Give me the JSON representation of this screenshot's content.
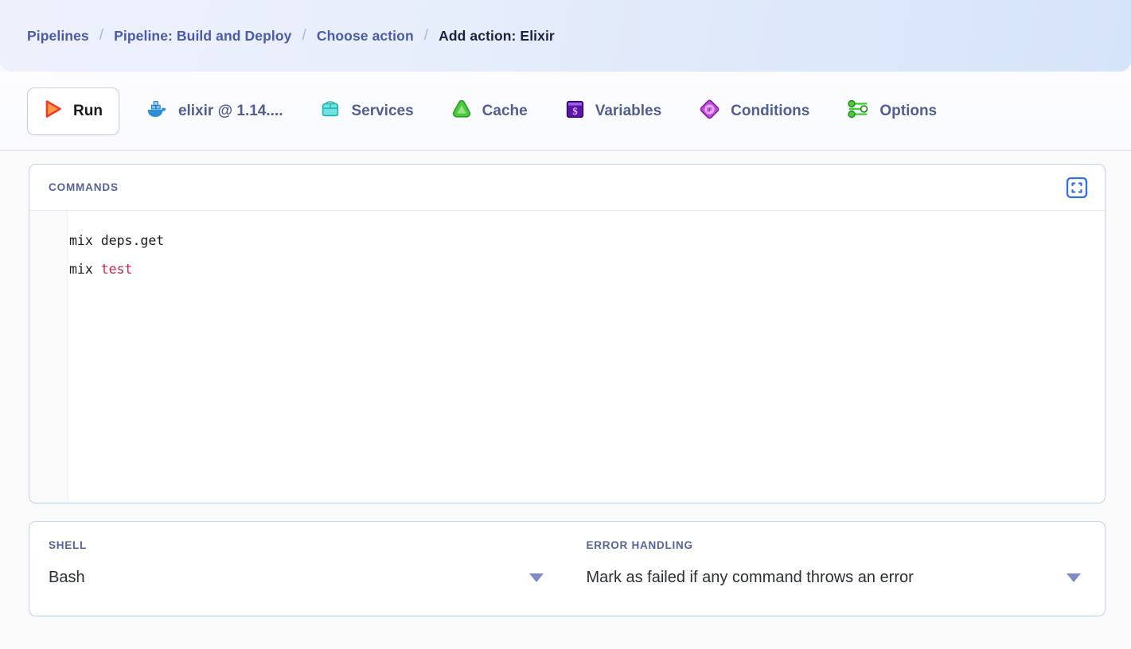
{
  "header": {
    "breadcrumb": [
      {
        "label": "Pipelines",
        "active": false
      },
      {
        "label": "Pipeline: Build and Deploy",
        "active": false
      },
      {
        "label": "Choose action",
        "active": false
      },
      {
        "label": "Add action: Elixir",
        "active": true
      }
    ],
    "separator": "/"
  },
  "tabs": {
    "run": {
      "label": "Run",
      "icon": "play-icon",
      "selected": true
    },
    "items": [
      {
        "label": "elixir @ 1.14....",
        "icon": "docker-whale-icon"
      },
      {
        "label": "Services",
        "icon": "services-crate-icon"
      },
      {
        "label": "Cache",
        "icon": "cache-triangle-icon"
      },
      {
        "label": "Variables",
        "icon": "variables-dollar-icon"
      },
      {
        "label": "Conditions",
        "icon": "conditions-if-diamond-icon"
      },
      {
        "label": "Options",
        "icon": "options-sliders-icon"
      }
    ]
  },
  "commands": {
    "title": "COMMANDS",
    "expand_icon": "fullscreen-expand-icon",
    "lines": [
      {
        "text": "mix deps.get",
        "highlight": null
      },
      {
        "text": "mix ",
        "highlight": "test"
      }
    ]
  },
  "settings": {
    "shell": {
      "label": "SHELL",
      "value": "Bash",
      "caret_icon": "chevron-down-icon"
    },
    "error_handling": {
      "label": "ERROR HANDLING",
      "value": "Mark as failed if any command throws an error",
      "caret_icon": "chevron-down-icon"
    }
  },
  "colors": {
    "accent_blue": "#2f6fed",
    "crumb_blue": "#4a5baf",
    "label_blue": "#56639b",
    "code_red": "#c7254e",
    "panel_border": "#c3d3ef"
  }
}
